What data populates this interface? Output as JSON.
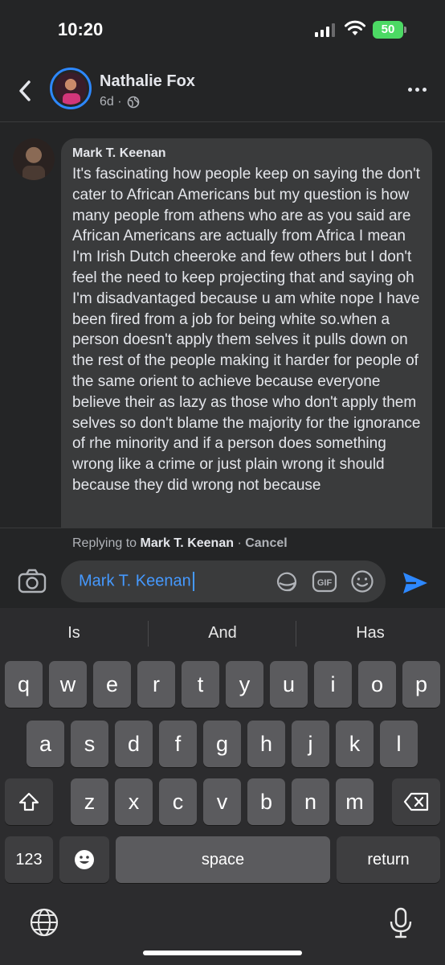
{
  "status_bar": {
    "time": "10:20",
    "battery": "50"
  },
  "header": {
    "name": "Nathalie Fox",
    "meta": "6d ·"
  },
  "comment": {
    "author": "Mark T. Keenan",
    "text": "It's fascinating how people keep on saying the don't cater to African Americans but my question is how many people from athens who are as you said are African Americans are actually from Africa I mean  I'm Irish Dutch cheeroke and few others but I don't feel the need to keep projecting that and saying oh I'm disadvantaged because u am white nope I have been fired from a job for being white so.when a person doesn't apply them selves it pulls down on the rest of the people making it harder for people of the same orient to achieve because everyone believe their as lazy as those who don't apply them selves so don't blame the majority for the ignorance of rhe minority and if a person does something wrong like a crime or just plain wrong it should because they did wrong not because"
  },
  "reply": {
    "prefix": "Replying to",
    "target": "Mark T. Keenan",
    "separator": "·",
    "cancel": "Cancel",
    "input_value": "Mark T. Keenan"
  },
  "keyboard": {
    "suggestions": [
      "Is",
      "And",
      "Has"
    ],
    "row1": [
      "q",
      "w",
      "e",
      "r",
      "t",
      "y",
      "u",
      "i",
      "o",
      "p"
    ],
    "row2": [
      "a",
      "s",
      "d",
      "f",
      "g",
      "h",
      "j",
      "k",
      "l"
    ],
    "row3": [
      "z",
      "x",
      "c",
      "v",
      "b",
      "n",
      "m"
    ],
    "numbers": "123",
    "space": "space",
    "return": "return"
  },
  "colors": {
    "accent": "#2d88ff",
    "mention": "#4599ff",
    "battery": "#4cd964"
  }
}
